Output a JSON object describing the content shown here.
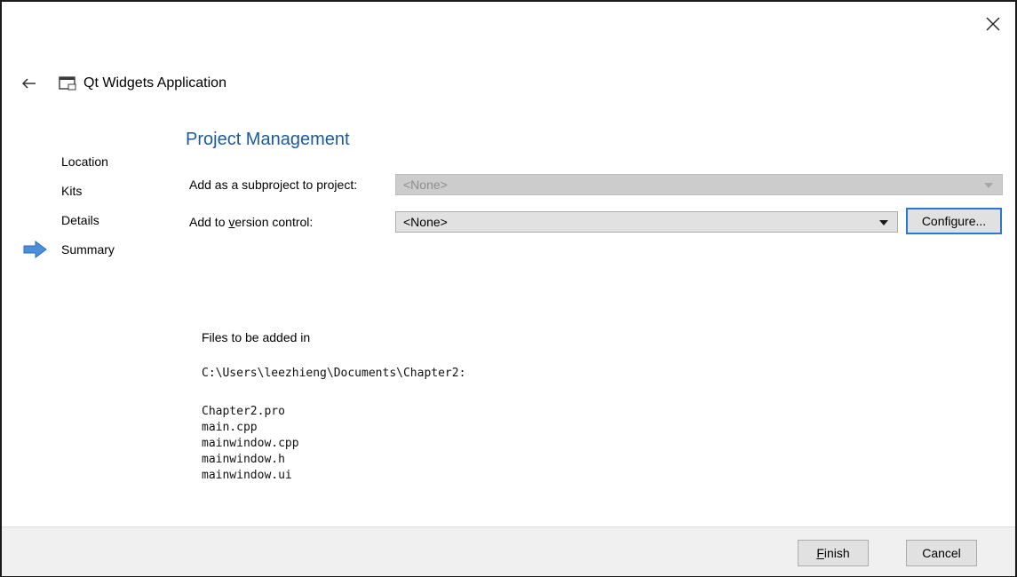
{
  "window": {
    "close_icon": "close-icon"
  },
  "header": {
    "title": "Qt Widgets Application"
  },
  "nav": {
    "items": [
      {
        "label": "Location"
      },
      {
        "label": "Kits"
      },
      {
        "label": "Details"
      },
      {
        "label": "Summary",
        "current": true
      }
    ]
  },
  "main": {
    "section_title": "Project Management",
    "subproject_label": "Add as a subproject to project:",
    "subproject_value": "<None>",
    "vcs_label": "Add to version control:",
    "vcs_value": "<None>",
    "configure_label": "Configure...",
    "files_intro": "Files to be added in",
    "files_path": "C:\\Users\\leezhieng\\Documents\\Chapter2:",
    "files": [
      "Chapter2.pro",
      "main.cpp",
      "mainwindow.cpp",
      "mainwindow.h",
      "mainwindow.ui"
    ]
  },
  "footer": {
    "finish_label": "Finish",
    "cancel_label": "Cancel"
  },
  "colors": {
    "title": "#1c5a9e",
    "arrow": "#4c8fd8",
    "focus": "#2b78d2"
  }
}
